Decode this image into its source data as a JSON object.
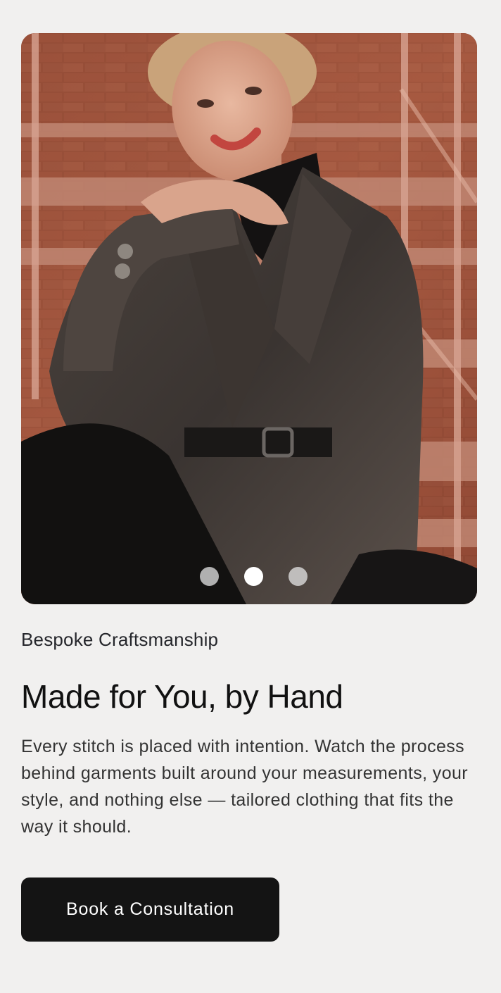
{
  "media": {
    "image_alt": "Smiling woman in a checked oversized blazer with a black belt, seated on rust-red metal stairs against a brick wall",
    "carousel": {
      "slides_count": 3,
      "active_index": 1
    }
  },
  "content": {
    "eyebrow": "Bespoke Craftsmanship",
    "headline": "Made for You, by Hand",
    "body": "Every stitch is placed with intention. Watch the process behind garments built around your measurements, your style, and nothing else — tailored clothing that fits the way it should."
  },
  "cta": {
    "label": "Book a Consultation"
  },
  "colors": {
    "page_background": "#f1f0ef",
    "button_background": "#141414",
    "button_text": "#ffffff",
    "heading_text": "#111111",
    "body_text": "#333333"
  }
}
